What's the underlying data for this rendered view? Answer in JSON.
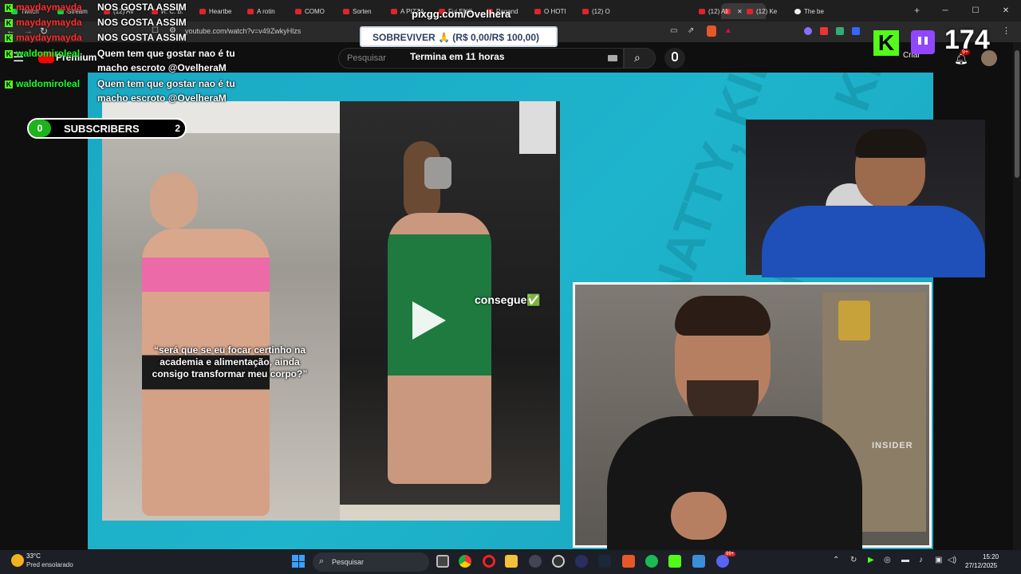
{
  "browser": {
    "tabs": [
      {
        "label": "Twitch",
        "favicon": "kick-icon"
      },
      {
        "label": "Stream",
        "favicon": "kick-icon"
      },
      {
        "label": "(12) AV",
        "favicon": "youtube-icon"
      },
      {
        "label": "И. С. Б.",
        "favicon": "youtube-icon"
      },
      {
        "label": "Heartbe",
        "favicon": "youtube-icon"
      },
      {
        "label": "A rotin",
        "favicon": "youtube-icon"
      },
      {
        "label": "COMO",
        "favicon": "youtube-icon"
      },
      {
        "label": "Sorten",
        "favicon": "youtube-icon"
      },
      {
        "label": "A PIZZA",
        "favicon": "youtube-icon"
      },
      {
        "label": "Fui ENG",
        "favicon": "youtube-icon"
      },
      {
        "label": "Pagand",
        "favicon": "youtube-icon"
      },
      {
        "label": "O HOTI",
        "favicon": "youtube-icon"
      },
      {
        "label": "(12) O",
        "favicon": "youtube-icon"
      },
      {
        "label": "",
        "favicon": "youtube-icon",
        "active": true
      },
      {
        "label": "(12) Ali",
        "favicon": "youtube-icon"
      },
      {
        "label": "(12) Ke",
        "favicon": "youtube-icon"
      },
      {
        "label": "The be",
        "favicon": "white-icon"
      }
    ],
    "url": "youtube.com/watch?v=v49ZwkyHlzs"
  },
  "youtube": {
    "logo_label": "Premium",
    "search_placeholder": "Pesquisar",
    "create_label": "Criar",
    "notification_count": "9+"
  },
  "overlay": {
    "pix_domain": "pixgg.com/Ovelhera",
    "goal_label": "SOBREVIVER 🙏 (R$ 0,00/R$ 100,00)",
    "goal_sub": "Termina em 11 horas",
    "subs_left": "0",
    "subs_label": "SUBSCRIBERS",
    "subs_right": "2",
    "viewer_count": "174"
  },
  "chat": [
    {
      "user": "maydaymayda",
      "message": "NOS GOSTA ASSIM",
      "user_color": "red"
    },
    {
      "user": "maydaymayda",
      "message": "NOS GOSTA ASSIM",
      "user_color": "red"
    },
    {
      "user": "maydaymayda",
      "message": "NOS GOSTA ASSIM",
      "user_color": "red"
    },
    {
      "user": "waldomiroleal",
      "message": "Quem tem que gostar nao é tu",
      "message2": "macho escroto @OvelheraM",
      "user_color": "green"
    },
    {
      "user": "waldomiroleal",
      "message": "Quem tem que gostar nao é tu",
      "message2": "macho escroto @OvelheraM",
      "user_color": "green"
    }
  ],
  "video": {
    "caption_left": "“será que se eu focar certinho na academia e alimentação, ainda consigo transformar meu corpo?”",
    "caption_right": "consegue✅",
    "shorts_text": "INSIDER"
  },
  "taskbar": {
    "weather_temp": "33°C",
    "weather_desc": "Pred ensolarado",
    "search_placeholder": "Pesquisar",
    "time": "15:20",
    "date": "27/12/2025",
    "discord_badge": "99+"
  }
}
